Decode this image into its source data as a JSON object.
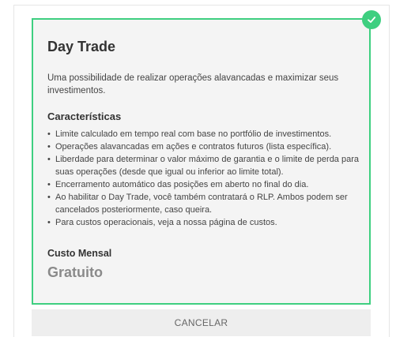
{
  "plan": {
    "title": "Day Trade",
    "description": "Uma possibilidade de realizar operações alavancadas e maximizar seus investimentos.",
    "features_title": "Características",
    "features": [
      "Limite calculado em tempo real com base no portfólio de investimentos.",
      "Operações alavancadas em ações e contratos futuros (lista específica).",
      "Liberdade para determinar o valor máximo de garantia e o limite de perda para suas operações (desde que igual ou inferior ao limite total).",
      "Encerramento automático das posições em aberto no final do dia.",
      "Ao habilitar o Day Trade, você também contratará o RLP. Ambos podem ser cancelados posteriormente, caso queira.",
      "Para custos operacionais, veja a nossa página de custos."
    ],
    "cost_label": "Custo Mensal",
    "cost_value": "Gratuito",
    "selected_icon": "check-icon"
  },
  "actions": {
    "cancel_label": "CANCELAR"
  },
  "colors": {
    "accent": "#3ecf80",
    "card_background": "#f4f4f4",
    "text": "#333333",
    "muted_price": "#8a8a8a",
    "button_background": "#eeeeee"
  }
}
